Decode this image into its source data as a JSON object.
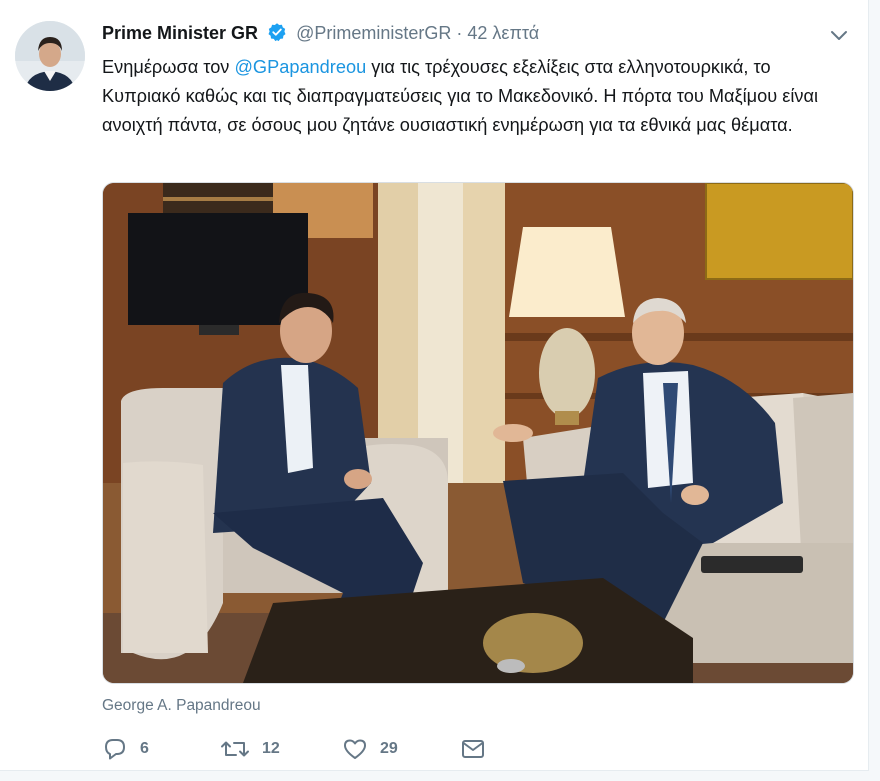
{
  "tweet": {
    "display_name": "Prime Minister GR",
    "handle": "@PrimeministerGR",
    "separator": "·",
    "time": "42 λεπτά",
    "text_before": "Ενημέρωσα τον ",
    "mention": "@GPapandreou",
    "text_after": " για τις τρέχουσες εξελίξεις στα ελληνοτουρκικά, το Κυπριακό καθώς και τις διαπραγματεύσεις για το Μακεδονικό. Η πόρτα του Μαξίμου είναι ανοιχτή πάντα, σε όσους μου ζητάνε ουσιαστική ενημέρωση για τα εθνικά μας θέματα.",
    "photo_caption": "George A. Papandreou",
    "replies": "6",
    "retweets": "12",
    "likes": "29"
  },
  "icons": {
    "verified": "verified-badge-icon",
    "more": "chevron-down-icon",
    "reply": "reply-icon",
    "retweet": "retweet-icon",
    "like": "heart-icon",
    "dm": "envelope-icon"
  },
  "colors": {
    "primary_text": "#14171a",
    "secondary_text": "#657786",
    "link": "#1b95e0",
    "verified": "#1da1f2"
  }
}
